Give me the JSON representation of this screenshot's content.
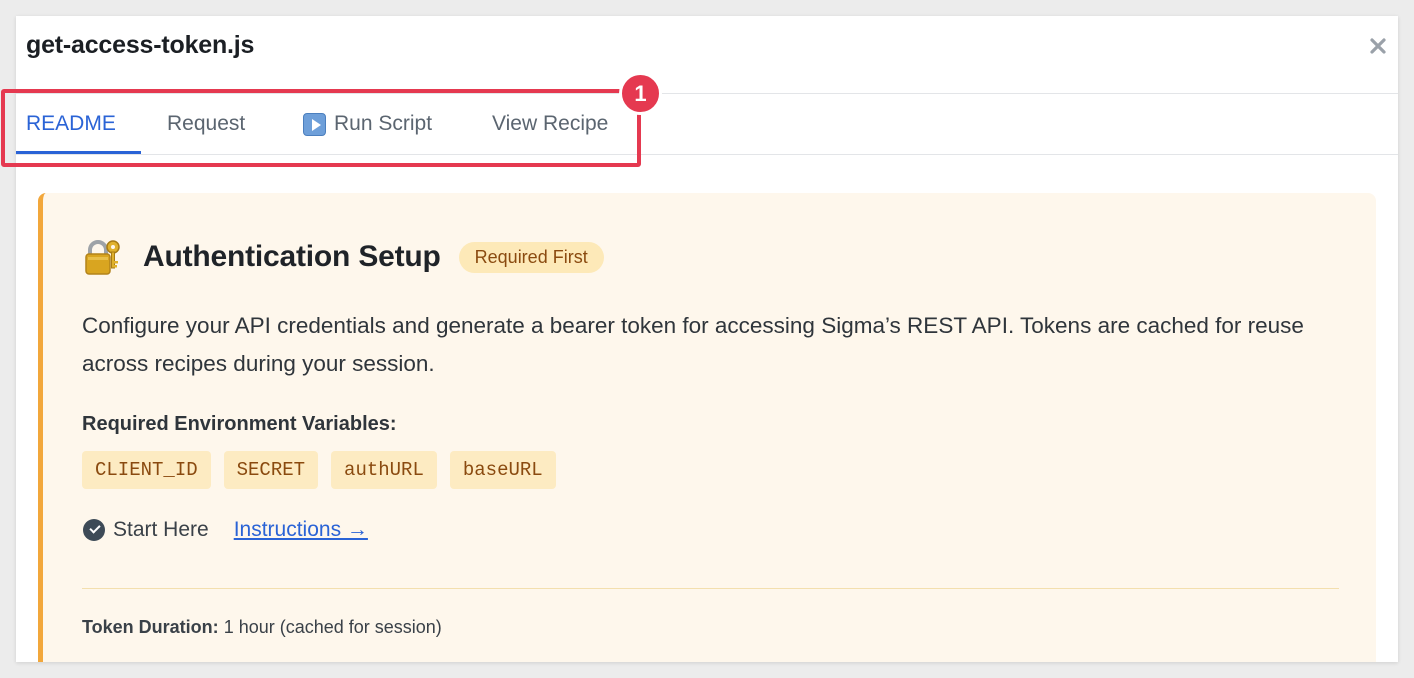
{
  "modal": {
    "title": "get-access-token.js",
    "close_icon": "close-icon"
  },
  "tabs": [
    {
      "label": "README",
      "active": true
    },
    {
      "label": "Request",
      "active": false
    },
    {
      "label": "Run Script",
      "active": false,
      "icon": "play-button-icon"
    },
    {
      "label": "View Recipe",
      "active": false
    }
  ],
  "annotation": {
    "badge_number": "1",
    "color": "#e53950"
  },
  "card": {
    "icon": "locked-with-key-icon",
    "title": "Authentication Setup",
    "badge": "Required First",
    "description": "Configure your API credentials and generate a bearer token for accessing Sigma’s REST API. Tokens are cached for reuse across recipes during your session.",
    "env_label": "Required Environment Variables:",
    "env_vars": [
      "CLIENT_ID",
      "SECRET",
      "authURL",
      "baseURL"
    ],
    "start_here": "Start Here",
    "instructions_link": "Instructions →",
    "token_duration_label": "Token Duration:",
    "token_duration_value": "1 hour (cached for session)"
  },
  "colors": {
    "accent": "#2a63d6",
    "card_bg": "#fef7ec",
    "card_border": "#f2a73b",
    "badge_bg": "#fde9b8",
    "badge_text": "#8a4a0f"
  }
}
